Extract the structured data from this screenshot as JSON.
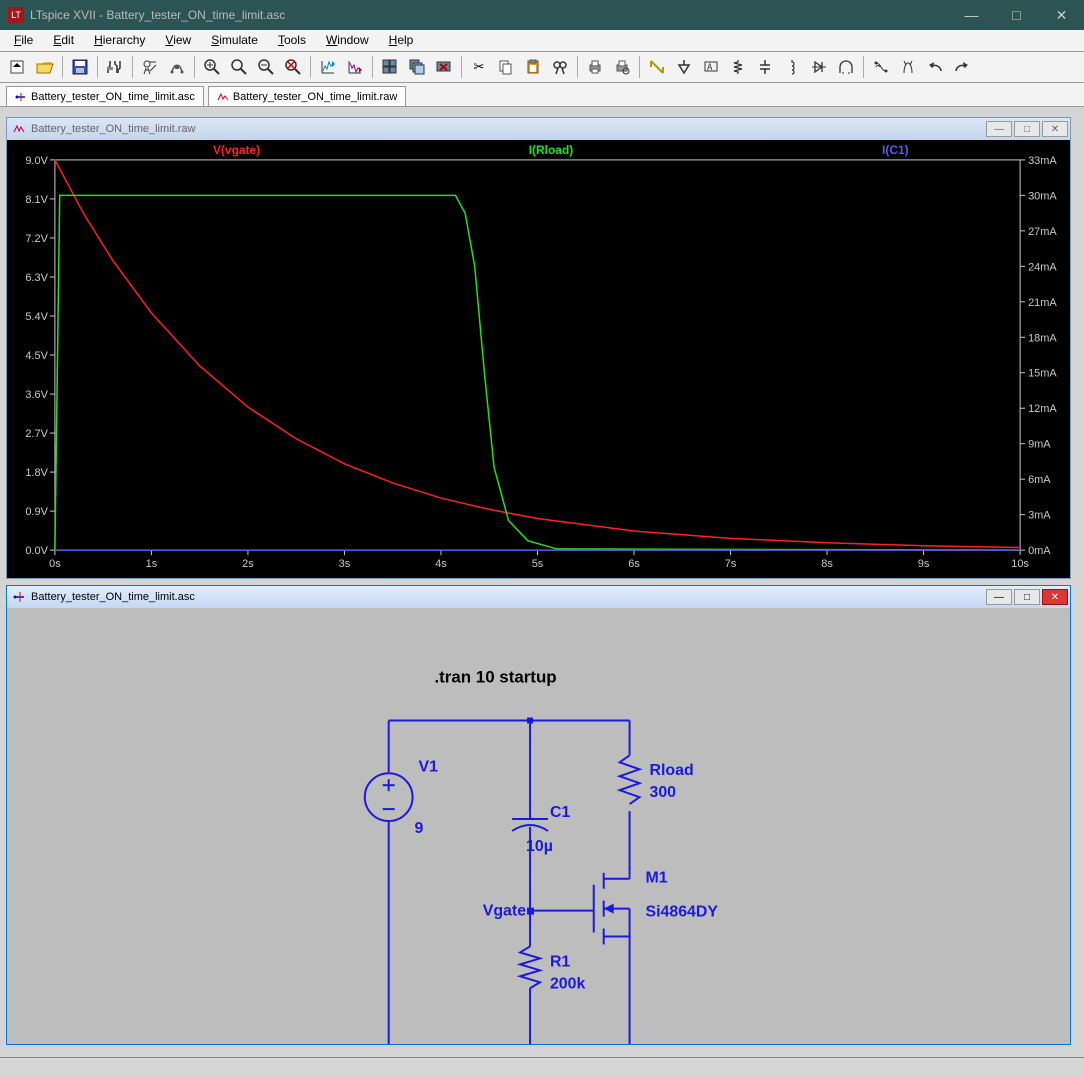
{
  "app": {
    "title": "LTspice XVII - Battery_tester_ON_time_limit.asc"
  },
  "menu": [
    "File",
    "Edit",
    "Hierarchy",
    "View",
    "Simulate",
    "Tools",
    "Window",
    "Help"
  ],
  "tabs": [
    {
      "label": "Battery_tester_ON_time_limit.asc"
    },
    {
      "label": "Battery_tester_ON_time_limit.raw"
    }
  ],
  "plot_win": {
    "title": "Battery_tester_ON_time_limit.raw"
  },
  "sch_win": {
    "title": "Battery_tester_ON_time_limit.asc"
  },
  "schematic": {
    "directive": ".tran 10 startup",
    "V1": {
      "name": "V1",
      "value": "9"
    },
    "C1": {
      "name": "C1",
      "value": "10µ"
    },
    "R1": {
      "name": "R1",
      "value": "200k"
    },
    "Rload": {
      "name": "Rload",
      "value": "300"
    },
    "M1": {
      "name": "M1",
      "value": "Si4864DY"
    },
    "node_vgate": "Vgate"
  },
  "chart_data": {
    "type": "line",
    "xlabel": "",
    "ylabel_left": "V",
    "ylabel_right": "mA",
    "xlim": [
      0,
      10
    ],
    "ylim_left": [
      0.0,
      9.0
    ],
    "ylim_right": [
      0,
      33
    ],
    "xticks": [
      "0s",
      "1s",
      "2s",
      "3s",
      "4s",
      "5s",
      "6s",
      "7s",
      "8s",
      "9s",
      "10s"
    ],
    "yticks_left": [
      "0.0V",
      "0.9V",
      "1.8V",
      "2.7V",
      "3.6V",
      "4.5V",
      "5.4V",
      "6.3V",
      "7.2V",
      "8.1V",
      "9.0V"
    ],
    "yticks_right": [
      "0mA",
      "3mA",
      "6mA",
      "9mA",
      "12mA",
      "15mA",
      "18mA",
      "21mA",
      "24mA",
      "27mA",
      "30mA",
      "33mA"
    ],
    "series": [
      {
        "name": "V(vgate)",
        "color": "#ff2020",
        "axis": "left",
        "x": [
          0,
          0.3,
          0.6,
          1.0,
          1.5,
          2.0,
          2.5,
          3.0,
          3.5,
          4.0,
          4.5,
          5.0,
          6.0,
          7.0,
          8.0,
          9.0,
          10.0
        ],
        "y": [
          9.0,
          7.75,
          6.68,
          5.47,
          4.25,
          3.3,
          2.57,
          1.99,
          1.55,
          1.2,
          0.94,
          0.73,
          0.44,
          0.27,
          0.17,
          0.1,
          0.06
        ]
      },
      {
        "name": "I(Rload)",
        "color": "#20e020",
        "axis": "right",
        "x": [
          0,
          0.05,
          4.15,
          4.25,
          4.35,
          4.45,
          4.55,
          4.7,
          4.9,
          5.2,
          10
        ],
        "y": [
          0,
          30,
          30,
          28.5,
          24,
          15,
          7,
          2.5,
          0.8,
          0.1,
          0
        ]
      },
      {
        "name": "I(C1)",
        "color": "#5a5ae8",
        "axis": "right",
        "x": [
          0,
          10
        ],
        "y": [
          0,
          0
        ]
      }
    ]
  }
}
